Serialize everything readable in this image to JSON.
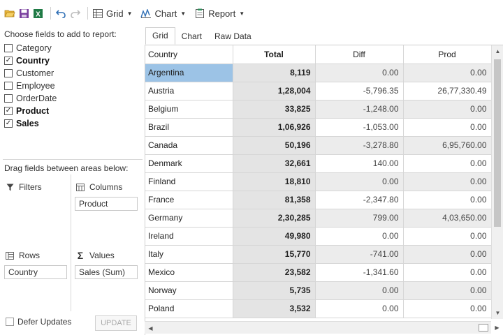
{
  "toolbar": {
    "icons": [
      "open-folder-icon",
      "save-icon",
      "excel-export-icon",
      "undo-icon",
      "redo-icon"
    ],
    "grid_label": "Grid",
    "chart_label": "Chart",
    "report_label": "Report"
  },
  "fields_panel": {
    "title": "Choose fields to add to report:",
    "fields": [
      {
        "label": "Category",
        "checked": false
      },
      {
        "label": "Country",
        "checked": true
      },
      {
        "label": "Customer",
        "checked": false
      },
      {
        "label": "Employee",
        "checked": false
      },
      {
        "label": "OrderDate",
        "checked": false
      },
      {
        "label": "Product",
        "checked": true
      },
      {
        "label": "Sales",
        "checked": true
      }
    ]
  },
  "areas": {
    "title": "Drag fields between areas below:",
    "filters_label": "Filters",
    "columns_label": "Columns",
    "columns_value": "Product",
    "rows_label": "Rows",
    "rows_value": "Country",
    "values_label": "Values",
    "values_value": "Sales (Sum)"
  },
  "defer_updates_label": "Defer Updates",
  "update_button": "UPDATE",
  "tabs": [
    {
      "label": "Grid",
      "active": true
    },
    {
      "label": "Chart",
      "active": false
    },
    {
      "label": "Raw Data",
      "active": false
    }
  ],
  "grid": {
    "columns": [
      "Country",
      "Total",
      "Diff",
      "Prod"
    ],
    "rows": [
      {
        "country": "Argentina",
        "total": "8,119",
        "diff": "0.00",
        "prod": "0.00",
        "selected": true
      },
      {
        "country": "Austria",
        "total": "1,28,004",
        "diff": "-5,796.35",
        "prod": "26,77,330.49"
      },
      {
        "country": "Belgium",
        "total": "33,825",
        "diff": "-1,248.00",
        "prod": "0.00"
      },
      {
        "country": "Brazil",
        "total": "1,06,926",
        "diff": "-1,053.00",
        "prod": "0.00"
      },
      {
        "country": "Canada",
        "total": "50,196",
        "diff": "-3,278.80",
        "prod": "6,95,760.00"
      },
      {
        "country": "Denmark",
        "total": "32,661",
        "diff": "140.00",
        "prod": "0.00"
      },
      {
        "country": "Finland",
        "total": "18,810",
        "diff": "0.00",
        "prod": "0.00"
      },
      {
        "country": "France",
        "total": "81,358",
        "diff": "-2,347.80",
        "prod": "0.00"
      },
      {
        "country": "Germany",
        "total": "2,30,285",
        "diff": "799.00",
        "prod": "4,03,650.00"
      },
      {
        "country": "Ireland",
        "total": "49,980",
        "diff": "0.00",
        "prod": "0.00"
      },
      {
        "country": "Italy",
        "total": "15,770",
        "diff": "-741.00",
        "prod": "0.00"
      },
      {
        "country": "Mexico",
        "total": "23,582",
        "diff": "-1,341.60",
        "prod": "0.00"
      },
      {
        "country": "Norway",
        "total": "5,735",
        "diff": "0.00",
        "prod": "0.00"
      },
      {
        "country": "Poland",
        "total": "3,532",
        "diff": "0.00",
        "prod": "0.00"
      }
    ]
  },
  "colors": {
    "selected_row": "#9cc3e6",
    "total_column": "#e4e4e4",
    "alt_row": "#ececec"
  }
}
